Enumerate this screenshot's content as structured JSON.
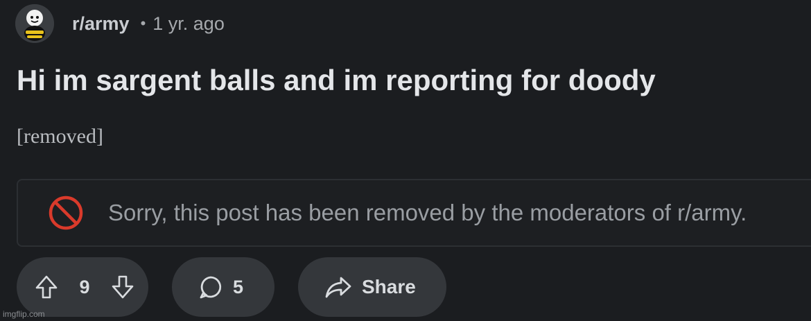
{
  "post": {
    "subreddit": "r/army",
    "separator": "•",
    "age": "1 yr. ago",
    "title": "Hi im sargent balls and im reporting for doody",
    "body": "[removed]"
  },
  "notice": {
    "text": "Sorry, this post has been removed by the moderators of r/army.",
    "icon": "prohibited-icon",
    "icon_color": "#d93a2b"
  },
  "actions": {
    "vote_count": "9",
    "comment_count": "5",
    "share_label": "Share"
  },
  "watermark": "imgflip.com",
  "colors": {
    "background": "#1b1d20",
    "pill": "#34373b"
  }
}
